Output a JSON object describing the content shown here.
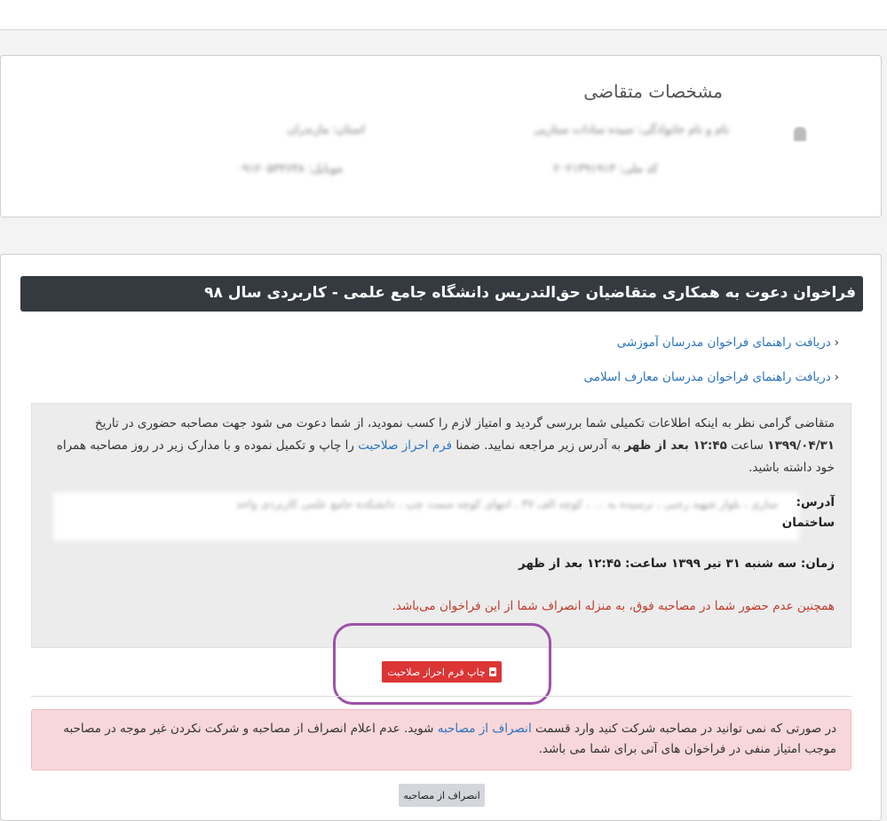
{
  "profile": {
    "title": "مشخصات متقاضی",
    "name_label": "نام و نام خانوادگی: سیده سادات ستاریی",
    "edu_label": "استان: مازندران",
    "code_label": "کد ملی: ۲۰۲۱۳۹۱۹۱۳",
    "mobile_label": "موبایل: ۰۹۱۲۰۵۳۳۶۴۸"
  },
  "invitation": {
    "title": "فراخوان دعوت به همکاری متقاضیان حق‌التدریس دانشگاه جامع علمی - کاربردی سال ۹۸",
    "links": [
      {
        "label": "دریافت راهنمای فراخوان مدرسان آموزشی"
      },
      {
        "label": "دریافت راهنمای فراخوان مدرسان معارف اسلامی"
      }
    ],
    "body": {
      "p1": "متقاضی گرامی نظر به اینکه اطلاعات تکمیلی شما بررسی گردید و امتیاز لازم را کسب نمودید، از شما دعوت می شود جهت مصاحبه حضوری در تاریخ",
      "date_time": "۱۳۹۹/۰۴/۳۱",
      "p2": "ساعت",
      "time": "۱۲:۴۵ بعد از ظهر",
      "p3": "به آدرس زیر مراجعه نمایید. ضمنا",
      "form_link": "فرم احراز صلاحیت",
      "p4": "را چاپ و تکمیل نموده و با مدارک زیر در روز مصاحبه همراه خود داشته باشید.",
      "address_label": "آدرس:",
      "address_label2": "ساختمان",
      "address_blurred": "ساری ، بلوار شهید رجبی ، نرسیده به ... ، کوچه الف ۳۷ ، انتهای کوچه سمت چپ ، دانشکده جامع علمی کاربردی واحد",
      "time_line": "زمان: سه شنبه ۳۱ تیر ۱۳۹۹ ساعت: ۱۲:۴۵ بعد از ظهر",
      "warning": "همچنین عدم حضور شما در مصاحبه فوق، به منزله انصراف شما از این فراخوان می‌باشد."
    },
    "print_button": "چاپ فرم احراز صلاحیت",
    "alert": {
      "t1": "در صورتی که نمی توانید در مصاحبه شرکت کنید وارد قسمت",
      "link": "انصراف از مصاحبه",
      "t2": "شوید. عدم اعلام انصراف از مصاحبه و شرکت نکردن غیر موجه در مصاحبه موجب امتیاز منفی در فراخوان های آتی برای شما می باشد."
    },
    "withdraw_button": "انصراف از مصاحبه"
  },
  "colors": {
    "title_bar": "#343a40",
    "link": "#2a73c0",
    "danger": "#dc3535",
    "alert_bg": "#f8d7da",
    "highlight": "#9c52a8"
  }
}
